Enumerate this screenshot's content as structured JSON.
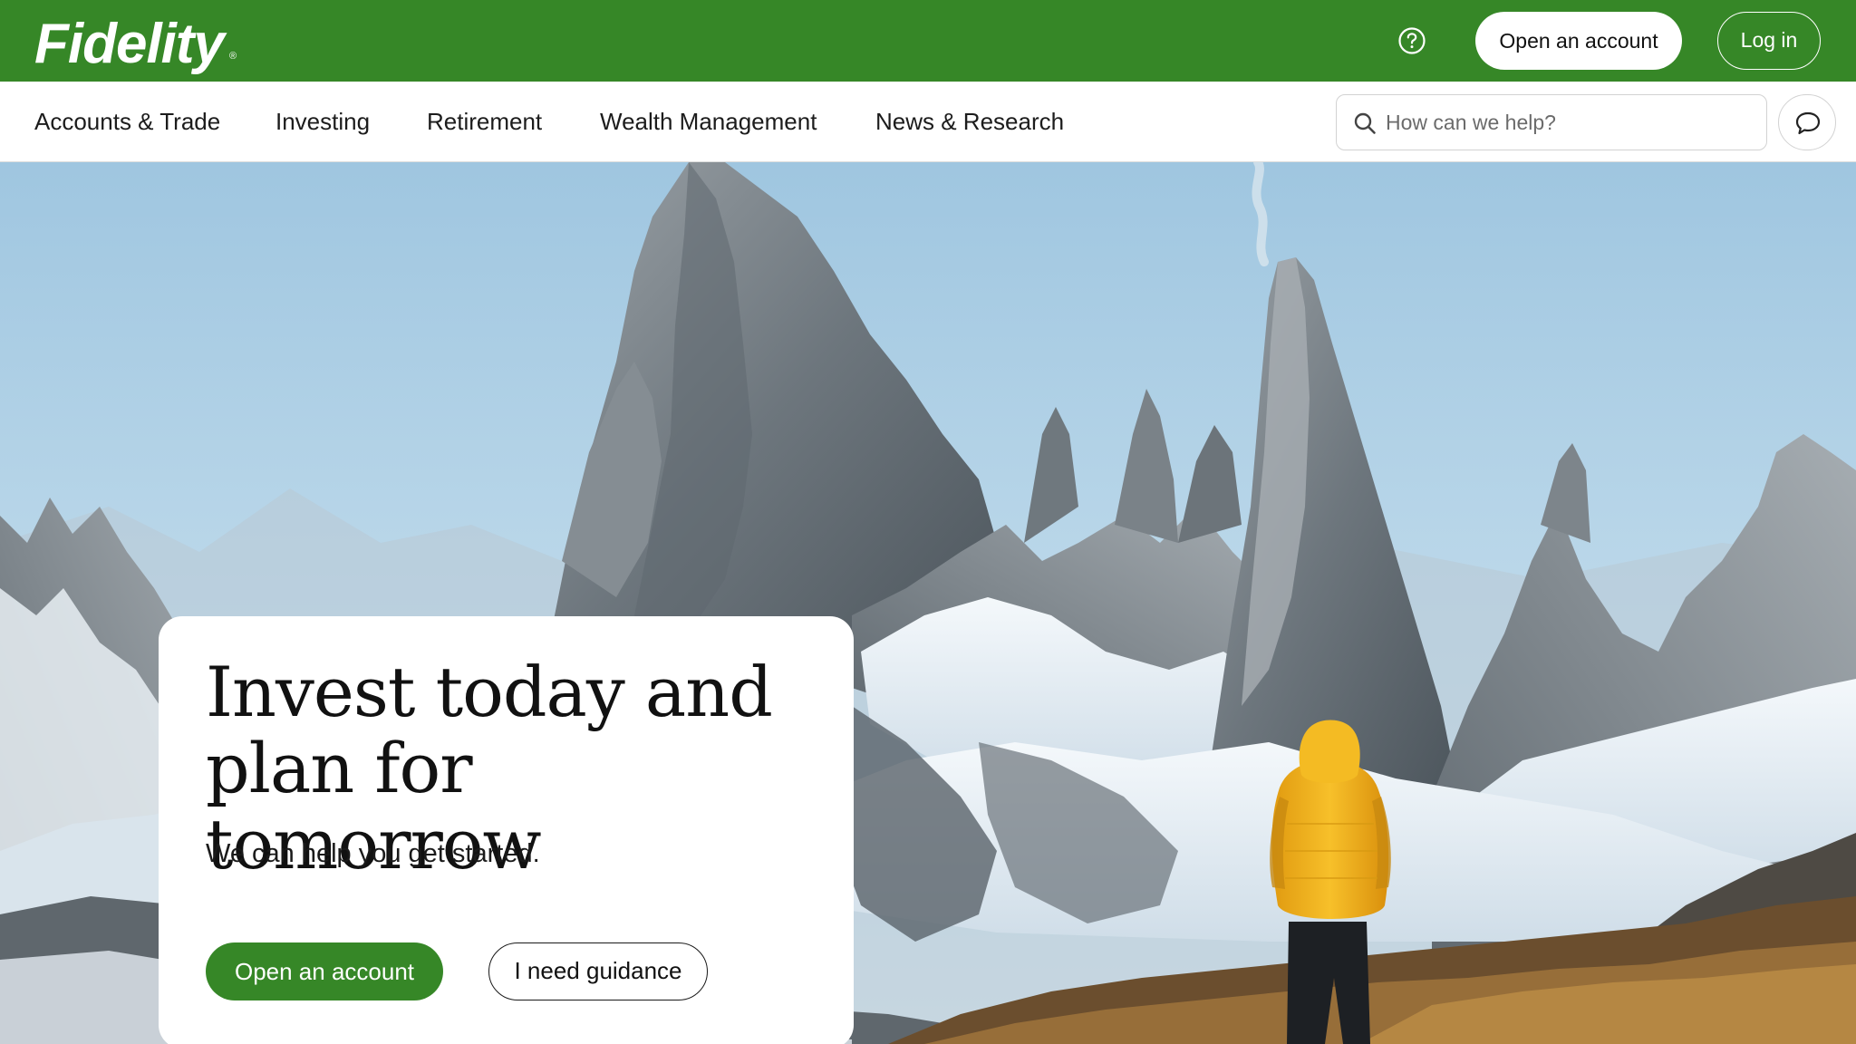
{
  "header": {
    "logo_text": "Fidelity",
    "logo_mark": "®",
    "help_icon": "question-circle-icon",
    "open_account_label": "Open an account",
    "login_label": "Log in"
  },
  "nav": {
    "items": [
      {
        "label": "Accounts & Trade"
      },
      {
        "label": "Investing"
      },
      {
        "label": "Retirement"
      },
      {
        "label": "Wealth Management"
      },
      {
        "label": "News & Research"
      }
    ],
    "search": {
      "placeholder": "How can we help?",
      "value": "",
      "icon": "search-icon"
    },
    "chat_icon": "chat-bubble-icon"
  },
  "hero": {
    "title": "Invest today and plan for tomorrow",
    "subtitle": "We can help you get started.",
    "primary_button": "Open an account",
    "secondary_button": "I need guidance"
  },
  "colors": {
    "brand_green": "#368727",
    "nav_text": "#1c1c1c",
    "sky": "#a9cde4",
    "jacket": "#f2b31b"
  }
}
